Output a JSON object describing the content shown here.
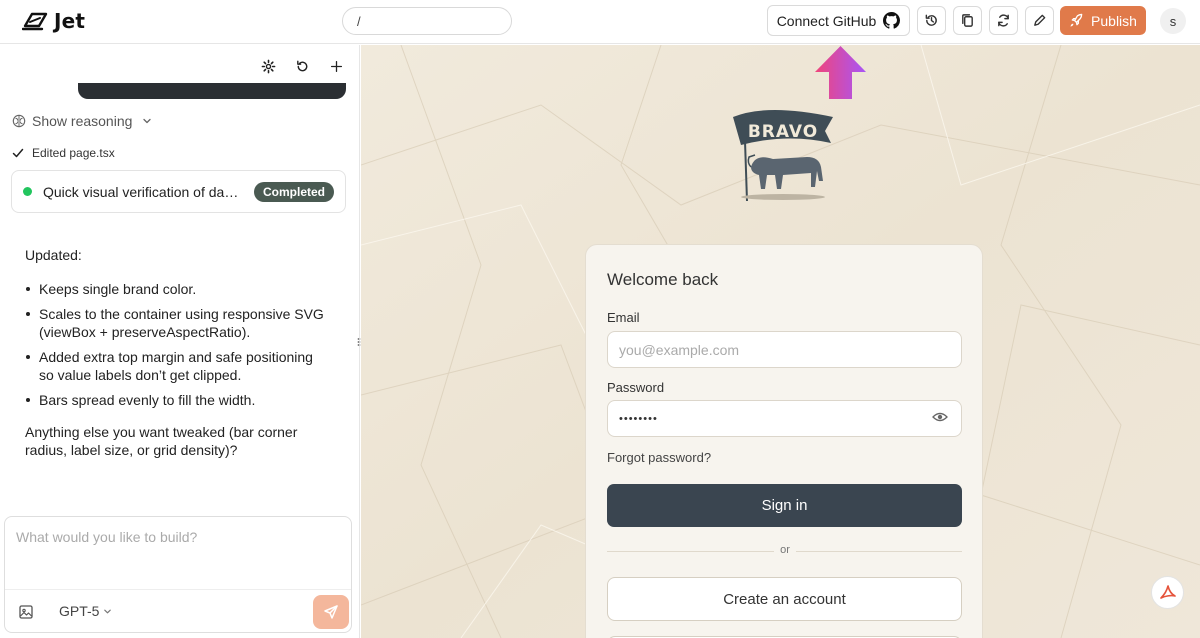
{
  "app": {
    "name": "Jet",
    "path_value": "/",
    "connect_github_label": "Connect GitHub",
    "publish_label": "Publish",
    "avatar_initial": "s",
    "accent_color": "#e07a4a"
  },
  "chat": {
    "show_reasoning_label": "Show reasoning",
    "edited_file_label": "Edited page.tsx",
    "task": {
      "text": "Quick visual verification of dashboard",
      "status": "Completed"
    },
    "message": {
      "intro": "Updated:",
      "bullets": [
        "Keeps single brand color.",
        "Scales to the container using responsive SVG (viewBox + preserveAspectRatio).",
        "Added extra top margin and safe positioning so value labels don’t get clipped.",
        "Bars spread evenly to fill the width."
      ],
      "outro": "Anything else you want tweaked (bar corner radius, label size, or grid density)?"
    },
    "composer": {
      "placeholder": "What would you like to build?",
      "model": "GPT-5"
    }
  },
  "preview": {
    "brand_logo_text": "BRAVO",
    "login": {
      "title": "Welcome back",
      "email_label": "Email",
      "email_placeholder": "you@example.com",
      "password_label": "Password",
      "password_value": "••••••••",
      "forgot_label": "Forgot password?",
      "signin_label": "Sign in",
      "or_label": "or",
      "create_label": "Create an account"
    }
  }
}
